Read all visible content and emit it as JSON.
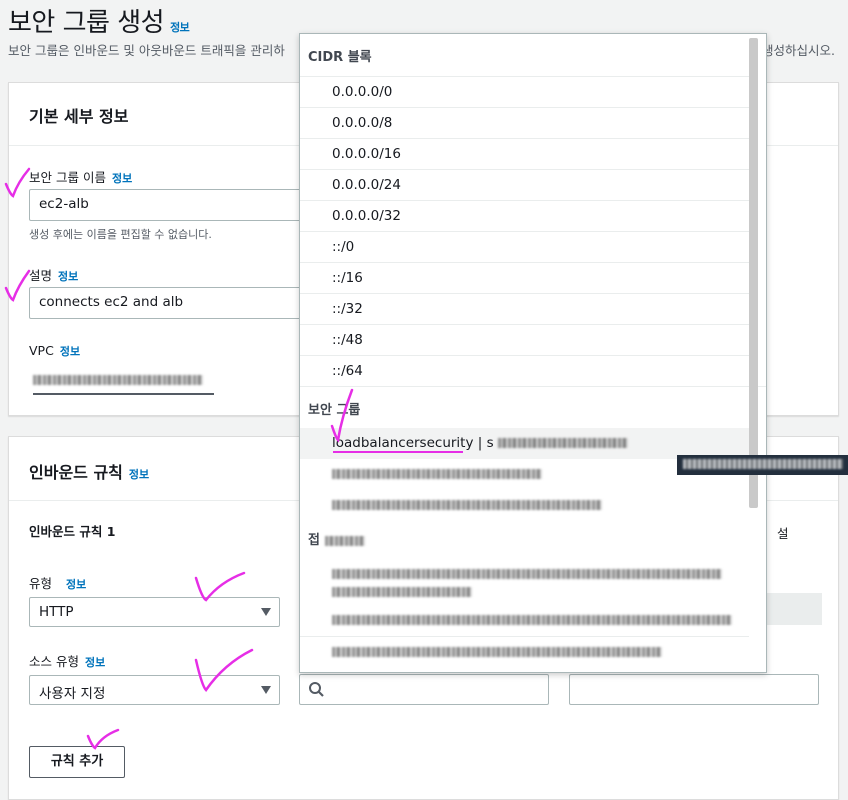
{
  "page": {
    "title": "보안 그룹 생성",
    "title_info": "정보",
    "description": "보안 그룹은 인바운드 및 아웃바운드 트래픽을 관리하",
    "description_tail": "생성하십시오."
  },
  "basic": {
    "header": "기본 세부 정보",
    "name_label": "보안 그룹 이름",
    "name_info": "정보",
    "name_value": "ec2-alb",
    "name_hint": "생성 후에는 이름을 편집할 수 없습니다.",
    "desc_label": "설명",
    "desc_info": "정보",
    "desc_value": "connects ec2 and alb",
    "vpc_label": "VPC",
    "vpc_info": "정보"
  },
  "inbound": {
    "header": "인바운드 규칙",
    "header_info": "정보",
    "rule_title": "인바운드 규칙 1",
    "type_label": "유형",
    "type_info": "정보",
    "type_value": "HTTP",
    "source_label": "소스 유형",
    "source_info": "정보",
    "source_value": "사용자 지정",
    "add_rule": "규칙 추가",
    "right_col_label": "설"
  },
  "dropdown": {
    "cidr_group": "CIDR 블록",
    "cidr_items": [
      "0.0.0.0/0",
      "0.0.0.0/8",
      "0.0.0.0/16",
      "0.0.0.0/24",
      "0.0.0.0/32",
      "::/0",
      "::/16",
      "::/32",
      "::/48",
      "::/64"
    ],
    "sg_group": "보안 그룹",
    "sg_first": "loadbalancersecurity",
    "sg_first_sep": "| s",
    "prefix_group": "접"
  },
  "colors": {
    "link": "#0073bb",
    "check": "#e62ee6",
    "underline": "#e62ee6"
  }
}
